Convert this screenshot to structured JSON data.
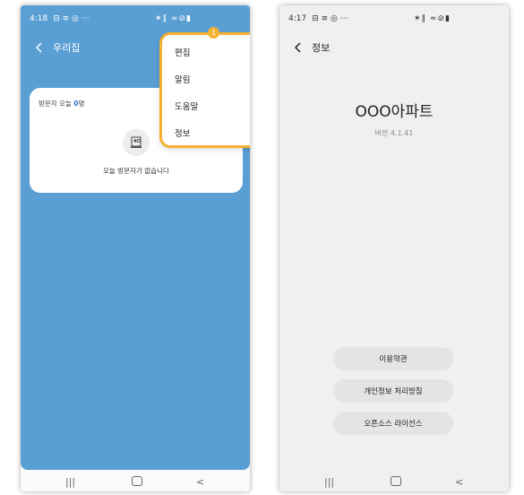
{
  "left": {
    "status": {
      "time": "4:18",
      "indicators": "⊟ ≡ ◎ ⋯",
      "right_icons": "✶∥ ≈⊘▮"
    },
    "title": "우리집",
    "card": {
      "visitor_prefix": "방문자 오늘 ",
      "visitor_count": "0",
      "visitor_suffix": "명",
      "empty_text": "오늘 방문자가 없습니다"
    },
    "menu": {
      "badge": "1",
      "items": [
        "편집",
        "알림",
        "도움말",
        "정보"
      ]
    },
    "accent": "#5a9fd4",
    "highlight": "#f4b030"
  },
  "right": {
    "status": {
      "time": "4:17",
      "indicators": "⊟ ≡ ◎ ⋯",
      "right_icons": "✶∥ ≈⊘▮"
    },
    "title": "정보",
    "app_name": "OOO아파트",
    "version": "버전 4.1.41",
    "buttons": [
      "이용약관",
      "개인정보 처리방침",
      "오픈소스 라이선스"
    ]
  },
  "navbar": {
    "recent": "|||",
    "back": "<"
  }
}
